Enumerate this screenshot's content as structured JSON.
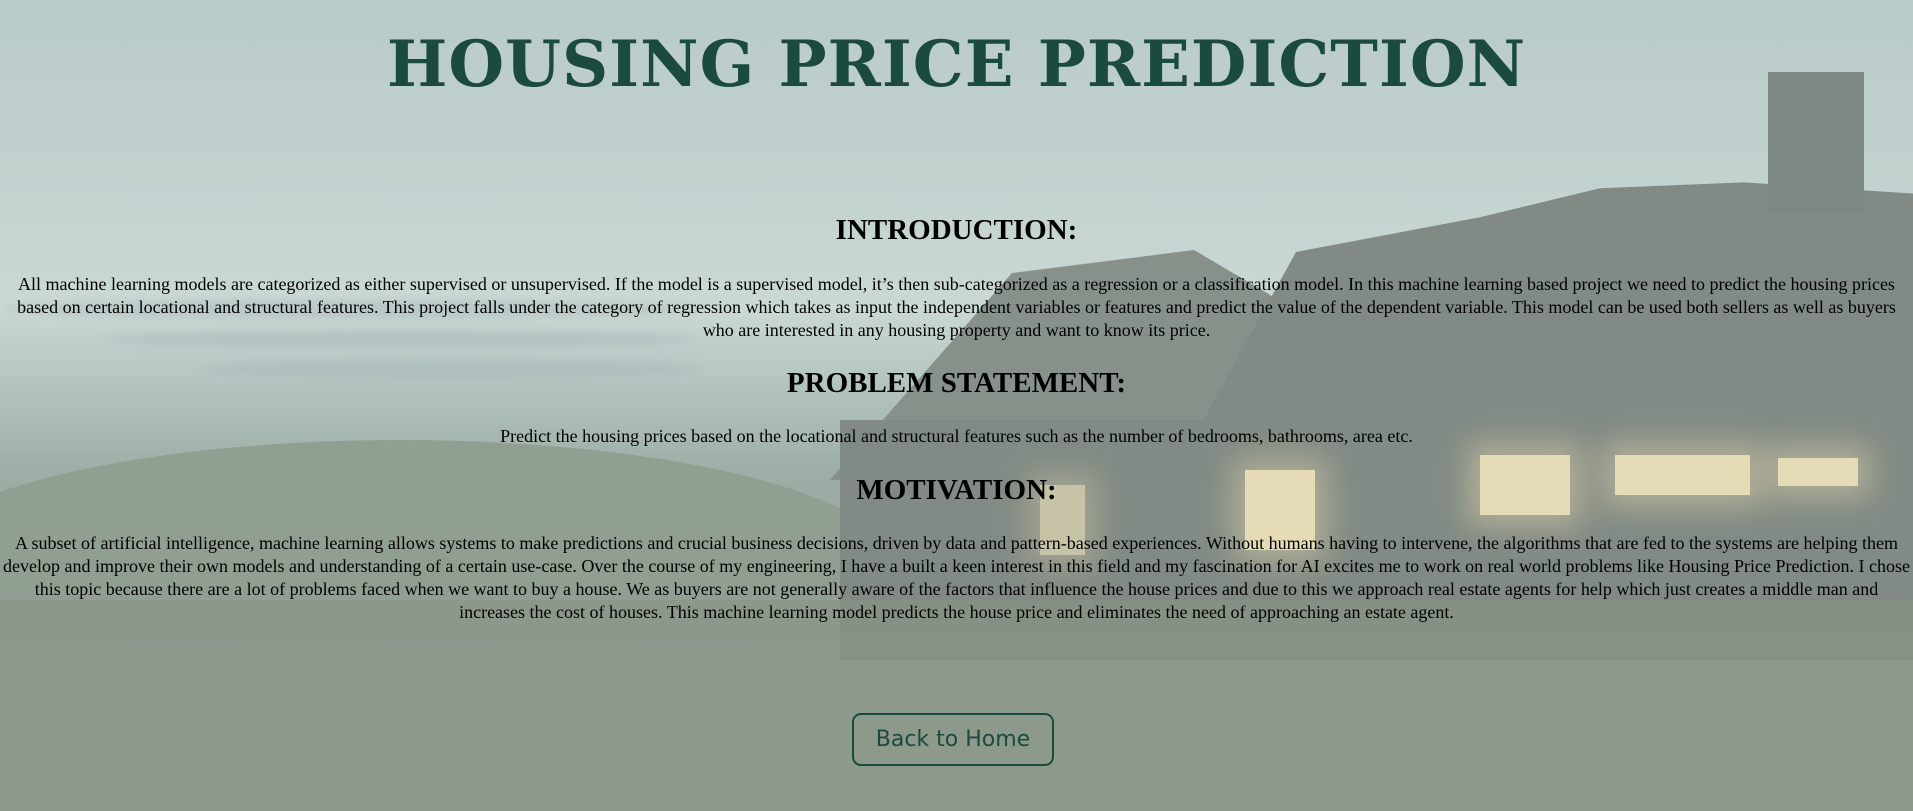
{
  "page": {
    "title": "HOUSING PRICE PREDICTION"
  },
  "sections": {
    "introduction": {
      "heading": "INTRODUCTION:",
      "text": "All machine learning models are categorized as either supervised or unsupervised. If the model is a supervised model, it’s then sub-categorized as a regression or a classification model. In this machine learning based project we need to predict the housing prices based on certain locational and structural features. This project falls under the category of regression which takes as input the independent variables or features and predict the value of the dependent variable. This model can be used both sellers as well as buyers who are interested in any housing property and want to know its price."
    },
    "problem": {
      "heading": "PROBLEM STATEMENT:",
      "text": "Predict the housing prices based on the locational and structural features such as the number of bedrooms, bathrooms, area etc."
    },
    "motivation": {
      "heading": "MOTIVATION:",
      "text": "A subset of artificial intelligence, machine learning allows systems to make predictions and crucial business decisions, driven by data and pattern-based experiences. Without humans having to intervene, the algorithms that are fed to the systems are helping them develop and improve their own models and understanding of a certain use-case. Over the course of my engineering, I have a built a keen interest in this field and my fascination for AI excites me to work on real world problems like Housing Price Prediction. I chose this topic because there are a lot of problems faced when we want to buy a house. We as buyers are not generally aware of the factors that influence the house prices and due to this we approach real estate agents for help which just creates a middle man and increases the cost of houses. This machine learning model predicts the house price and eliminates the need of approaching an estate agent."
    }
  },
  "actions": {
    "back_label": "Back to Home"
  },
  "colors": {
    "title": "#1b4a3f",
    "button_border": "#1b4a3f"
  }
}
